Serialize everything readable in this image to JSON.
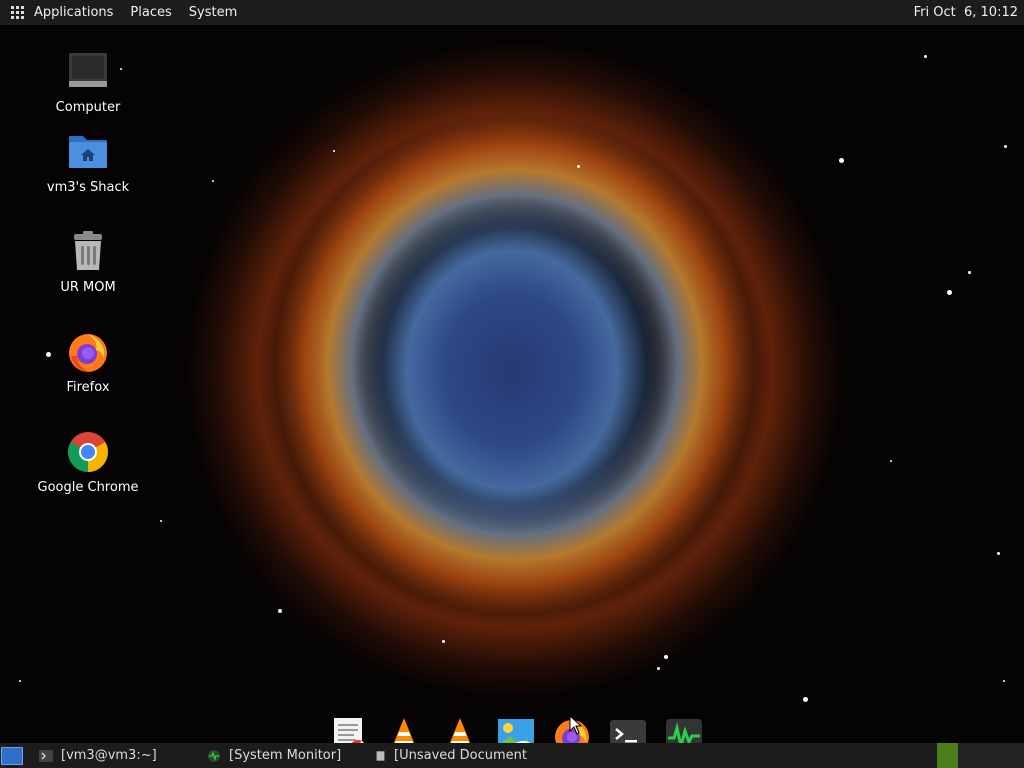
{
  "top_panel": {
    "menu": [
      "Applications",
      "Places",
      "System"
    ],
    "clock": "Fri Oct  6, 10:12"
  },
  "desktop_icons": [
    {
      "label": "Computer",
      "icon": "computer-icon"
    },
    {
      "label": "vm3's Shack",
      "icon": "home-folder-icon"
    },
    {
      "label": "UR MOM",
      "icon": "trash-icon"
    },
    {
      "label": "Firefox",
      "icon": "firefox-icon"
    },
    {
      "label": "Google Chrome",
      "icon": "chrome-icon"
    }
  ],
  "dock": [
    {
      "icon": "text-editor-icon"
    },
    {
      "icon": "vlc-icon"
    },
    {
      "icon": "vlc-icon"
    },
    {
      "icon": "image-viewer-icon"
    },
    {
      "icon": "firefox-icon"
    },
    {
      "icon": "terminal-icon"
    },
    {
      "icon": "system-monitor-icon"
    }
  ],
  "taskbar": [
    {
      "label": "[vm3@vm3:~]",
      "icon": "terminal-icon"
    },
    {
      "label": "[System Monitor]",
      "icon": "system-monitor-icon"
    },
    {
      "label": "[Unsaved Document",
      "icon": "text-editor-icon"
    }
  ],
  "colors": {
    "panel": "#1c1c1c",
    "workspace_active": "#4c7d1b",
    "show_desktop": "#2f6fc9"
  }
}
